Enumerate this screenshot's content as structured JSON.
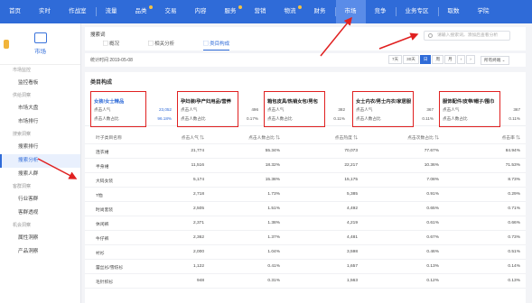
{
  "topnav": {
    "items": [
      {
        "label": "首页",
        "dot": false
      },
      {
        "label": "实时",
        "dot": false
      },
      {
        "label": "作战室",
        "dot": false
      },
      {
        "label": "流量",
        "dot": false
      },
      {
        "label": "品类",
        "dot": true
      },
      {
        "label": "交易",
        "dot": false
      },
      {
        "label": "内容",
        "dot": false
      },
      {
        "label": "服务",
        "dot": true
      },
      {
        "label": "营销",
        "dot": false
      },
      {
        "label": "物流",
        "dot": true
      },
      {
        "label": "财务",
        "dot": false
      },
      {
        "label": "市场",
        "dot": false,
        "active": true
      },
      {
        "label": "竞争",
        "dot": false
      },
      {
        "label": "业务专区",
        "dot": false
      },
      {
        "label": "取数",
        "dot": false
      },
      {
        "label": "学院",
        "dot": false
      }
    ]
  },
  "sidebar": {
    "brand_label": "市场",
    "groups": [
      {
        "title": "市场监控",
        "items": [
          {
            "label": "监控看板"
          }
        ]
      },
      {
        "title": "供给洞察",
        "items": [
          {
            "label": "市场大盘"
          },
          {
            "label": "市场排行"
          }
        ]
      },
      {
        "title": "搜索洞察",
        "items": [
          {
            "label": "搜索排行"
          },
          {
            "label": "搜索分析",
            "active": true
          },
          {
            "label": "搜索人群"
          }
        ]
      },
      {
        "title": "客群洞察",
        "items": [
          {
            "label": "行业客群"
          },
          {
            "label": "客群透视"
          }
        ]
      },
      {
        "title": "机会洞察",
        "items": [
          {
            "label": "属性洞察"
          },
          {
            "label": "产品洞察"
          }
        ]
      }
    ]
  },
  "header": {
    "title": "搜索词",
    "tabs": [
      {
        "label": "概况",
        "icon": "chart-icon"
      },
      {
        "label": "相关分析",
        "icon": "link-icon"
      },
      {
        "label": "类目构成",
        "icon": "category-icon",
        "active": true
      }
    ],
    "search_placeholder": "请输入搜索词，添加后查看分析"
  },
  "stat_bar": {
    "time": "统计时间 2019-05-08",
    "periods": [
      {
        "label": "7天"
      },
      {
        "label": "30天"
      },
      {
        "label": "日",
        "active": true
      },
      {
        "label": "周"
      },
      {
        "label": "月"
      },
      {
        "label": "‹"
      },
      {
        "label": "›"
      }
    ],
    "terminal": "所有终端 ⌄"
  },
  "section_title": "类目构成",
  "cards": [
    {
      "name": "女装/女士精品",
      "highlight": true,
      "row1_label": "点击人气",
      "row1_value": "23,052",
      "row2_label": "点击人数占比",
      "row2_value": "96.18%"
    },
    {
      "name": "孕妇装/孕产妇用品/营养",
      "highlight": false,
      "row1_label": "点击人气",
      "row1_value": "496",
      "row2_label": "点击人数占比",
      "row2_value": "0.17%"
    },
    {
      "name": "箱包皮具/热销女包/男包",
      "highlight": false,
      "row1_label": "点击人气",
      "row1_value": "382",
      "row2_label": "点击人数占比",
      "row2_value": "0.11%"
    },
    {
      "name": "女士内衣/男士内衣/家居服",
      "highlight": false,
      "row1_label": "点击人气",
      "row1_value": "367",
      "row2_label": "点击人数占比",
      "row2_value": "0.11%"
    },
    {
      "name": "服饰配件/皮带/帽子/围巾",
      "highlight": false,
      "row1_label": "点击人气",
      "row1_value": "367",
      "row2_label": "点击人数占比",
      "row2_value": "0.11%"
    }
  ],
  "table": {
    "headers": [
      "叶子类目名称",
      "点击人气 ⇅",
      "点击人数占比 ⇅",
      "点击热度 ⇅",
      "点击次数占比 ⇅",
      "点击率 ⇅"
    ],
    "rows": [
      [
        "连衣裙",
        "21,774",
        "55.34%",
        "70,073",
        "77.67%",
        "84.94%"
      ],
      [
        "半身裙",
        "11,516",
        "18.32%",
        "22,217",
        "10.36%",
        "71.53%"
      ],
      [
        "大码女装",
        "5,174",
        "15.38%",
        "15,175",
        "7.08%",
        "8.73%"
      ],
      [
        "T恤",
        "2,718",
        "1.73%",
        "5,385",
        "0.91%",
        "0.29%"
      ],
      [
        "时尚套装",
        "2,505",
        "1.51%",
        "4,492",
        "0.65%",
        "0.71%"
      ],
      [
        "休闲裤",
        "2,371",
        "1.38%",
        "4,219",
        "0.61%",
        "0.66%"
      ],
      [
        "牛仔裤",
        "2,362",
        "1.37%",
        "4,481",
        "0.67%",
        "0.73%"
      ],
      [
        "衬衫",
        "2,000",
        "1.04%",
        "3,598",
        "0.46%",
        "0.51%"
      ],
      [
        "蕾丝衫/雪纺衫",
        "1,122",
        "0.41%",
        "1,657",
        "0.13%",
        "0.14%"
      ],
      [
        "毛针织衫",
        "948",
        "0.31%",
        "1,563",
        "0.12%",
        "0.13%"
      ]
    ]
  },
  "colors": {
    "nav_blue": "#2f6bd8",
    "annotation_red": "#e02020"
  }
}
